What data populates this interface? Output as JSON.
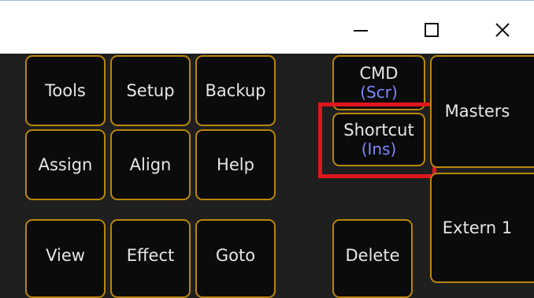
{
  "window": {
    "minimize_glyph": "—",
    "maximize_glyph": "☐",
    "close_glyph": "✕"
  },
  "keys": {
    "tools": "Tools",
    "setup": "Setup",
    "backup": "Backup",
    "assign": "Assign",
    "align": "Align",
    "help": "Help",
    "view": "View",
    "effect": "Effect",
    "goto": "Goto",
    "cmd": {
      "label": "CMD",
      "sub": "(Scr)"
    },
    "shortcut": {
      "label": "Shortcut",
      "sub": "(Ins)"
    },
    "delete": "Delete",
    "masters": "Masters",
    "extern1": "Extern 1"
  },
  "colors": {
    "key_border": "#b8860b",
    "sub_label": "#7f86ff",
    "highlight": "#e0161d"
  }
}
